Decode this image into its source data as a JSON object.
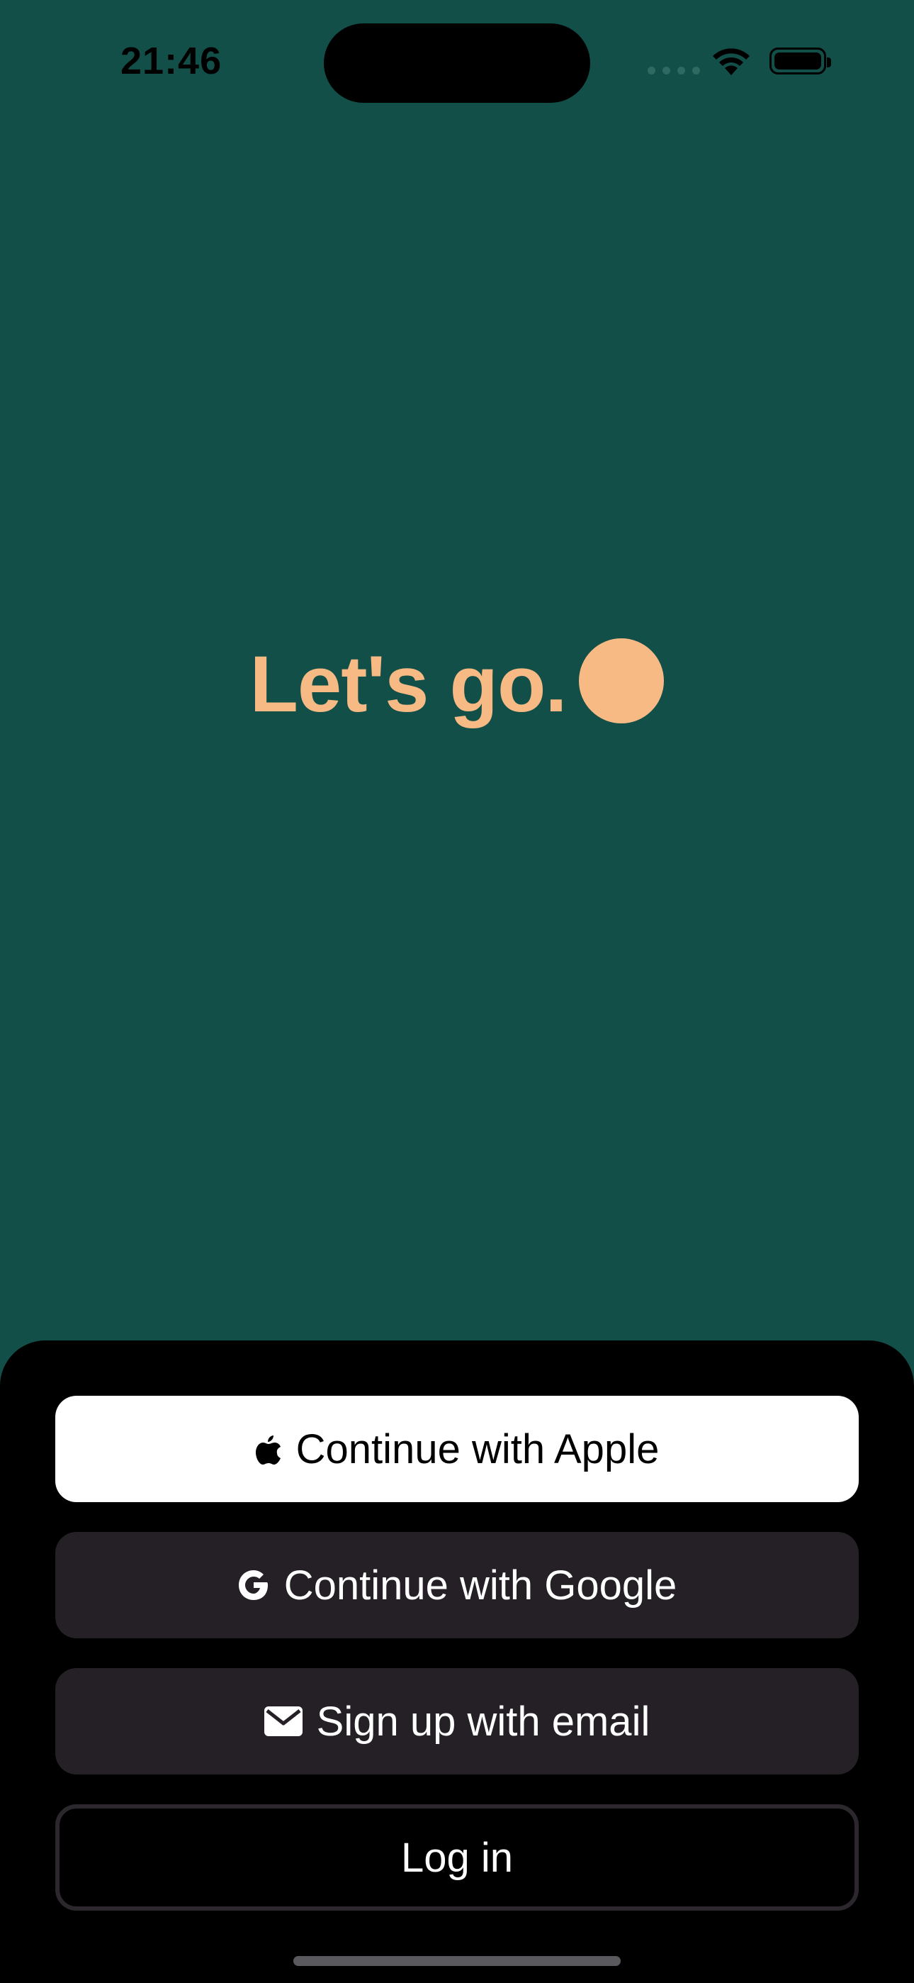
{
  "status_bar": {
    "time": "21:46"
  },
  "hero": {
    "text": "Let's go.",
    "accent_color": "#F7BA84"
  },
  "auth": {
    "apple_label": "Continue with Apple",
    "google_label": "Continue with Google",
    "email_label": "Sign up with email",
    "login_label": "Log in",
    "icons": {
      "apple": "apple-icon",
      "google": "google-icon",
      "email": "envelope-icon"
    }
  },
  "colors": {
    "background": "#114F48",
    "sheet": "#000000",
    "primary_button": "#FFFFFF",
    "secondary_button": "#242025"
  }
}
